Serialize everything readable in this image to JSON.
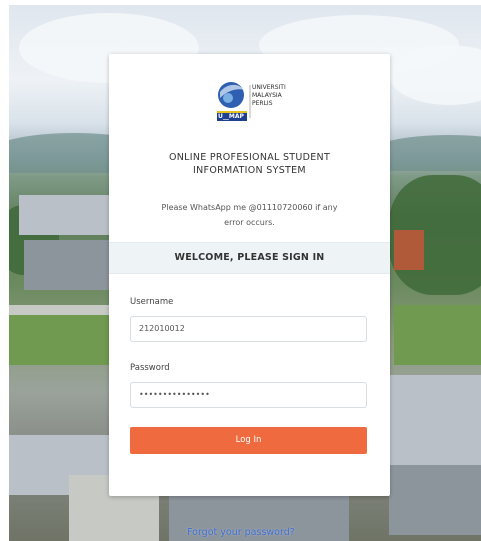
{
  "logo": {
    "line1": "UNIVERSITI",
    "line2": "MALAYSIA",
    "line3": "PERLIS",
    "mark": "U__MAP"
  },
  "system_title": {
    "line1": "ONLINE PROFESIONAL STUDENT",
    "line2": "INFORMATION SYSTEM"
  },
  "notice": {
    "line1": "Please WhatsApp me @01110720060 if any",
    "line2": "error occurs."
  },
  "welcome": "WELCOME, PLEASE SIGN IN",
  "form": {
    "username_label": "Username",
    "username_value": "212010012",
    "password_label": "Password",
    "password_value": "•••••••••••••••",
    "login_button": "Log In"
  },
  "forgot_link": "Forgot your password?"
}
